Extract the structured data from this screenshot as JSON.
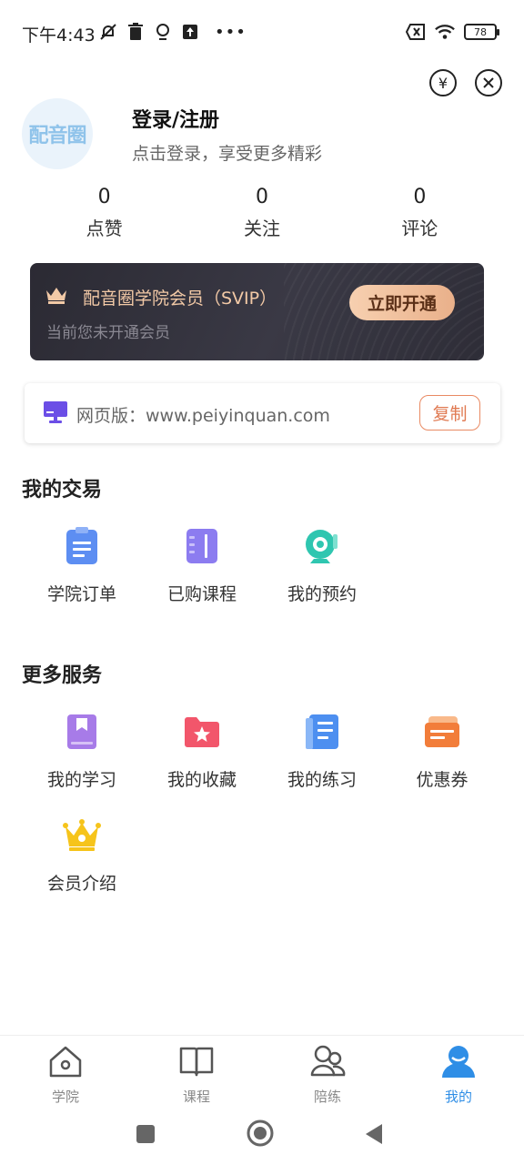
{
  "status_bar": {
    "time": "下午4:43",
    "battery": "78"
  },
  "profile": {
    "avatar_text": "配音圈",
    "login_title": "登录/注册",
    "login_subtitle": "点击登录，享受更多精彩"
  },
  "stats": [
    {
      "value": "0",
      "label": "点赞"
    },
    {
      "value": "0",
      "label": "关注"
    },
    {
      "value": "0",
      "label": "评论"
    }
  ],
  "vip": {
    "title": "配音圈学院会员（SVIP）",
    "subtitle": "当前您未开通会员",
    "button": "立即开通"
  },
  "web": {
    "text": "网页版：www.peiyinquan.com",
    "copy_button": "复制"
  },
  "transactions": {
    "title": "我的交易",
    "items": [
      {
        "label": "学院订单",
        "icon": "order-icon"
      },
      {
        "label": "已购课程",
        "icon": "purchased-course-icon"
      },
      {
        "label": "我的预约",
        "icon": "appointment-icon"
      }
    ]
  },
  "services": {
    "title": "更多服务",
    "items": [
      {
        "label": "我的学习",
        "icon": "study-icon"
      },
      {
        "label": "我的收藏",
        "icon": "favorites-icon"
      },
      {
        "label": "我的练习",
        "icon": "practice-icon"
      },
      {
        "label": "优惠券",
        "icon": "coupon-icon"
      },
      {
        "label": "会员介绍",
        "icon": "member-crown-icon"
      }
    ]
  },
  "bottom_nav": [
    {
      "label": "学院",
      "icon": "home-icon",
      "active": false
    },
    {
      "label": "课程",
      "icon": "book-icon",
      "active": false
    },
    {
      "label": "陪练",
      "icon": "people-icon",
      "active": false
    },
    {
      "label": "我的",
      "icon": "user-icon",
      "active": true
    }
  ],
  "colors": {
    "accent": "#2f8ee6",
    "vip_gold": "#f2c9a6",
    "copy_orange": "#e07a52"
  }
}
